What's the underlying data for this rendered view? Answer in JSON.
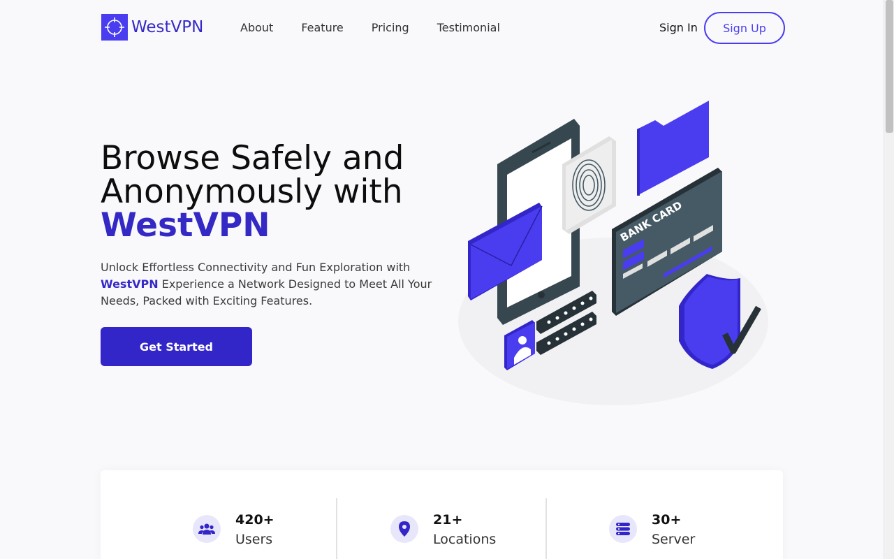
{
  "brand": {
    "name": "WestVPN",
    "accent": "#4a3df0",
    "dark_accent": "#3529c6"
  },
  "nav": {
    "items": [
      "About",
      "Feature",
      "Pricing",
      "Testimonial"
    ],
    "sign_in": "Sign In",
    "sign_up": "Sign Up"
  },
  "hero": {
    "title_line1": "Browse Safely and",
    "title_line2": "Anonymously with",
    "title_brand": "WestVPN",
    "desc_before": "Unlock Effortless Connectivity and Fun Exploration with",
    "desc_brand": "WestVPN",
    "desc_after": "Experience a Network Designed to Meet All Your Needs, Packed with Exciting Features.",
    "cta": "Get Started",
    "card_label": "BANK CARD"
  },
  "stats": [
    {
      "number": "420+",
      "label": "Users",
      "icon": "users-icon"
    },
    {
      "number": "21+",
      "label": "Locations",
      "icon": "location-pin-icon"
    },
    {
      "number": "30+",
      "label": "Server",
      "icon": "server-icon"
    }
  ]
}
